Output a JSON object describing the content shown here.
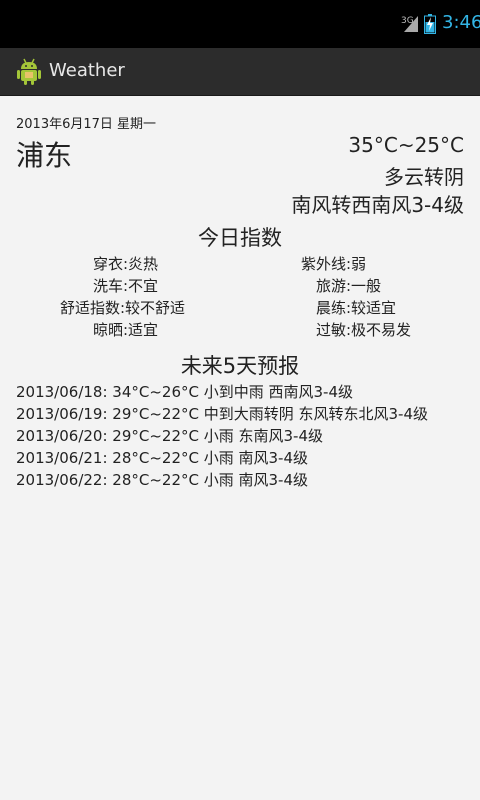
{
  "status_bar": {
    "network": "3G",
    "time": "3:46"
  },
  "action_bar": {
    "app_icon": "android-icon",
    "title": "Weather"
  },
  "current": {
    "date": "2013年6月17日 星期一",
    "city": "浦东",
    "temperature": "35°C~25°C",
    "weather": "多云转阴",
    "wind": "南风转西南风3-4级"
  },
  "indices": {
    "title": "今日指数",
    "items": [
      "穿衣:炎热",
      "紫外线:弱",
      "洗车:不宜",
      "旅游:一般",
      "舒适指数:较不舒适",
      "晨练:较适宜",
      "晾晒:适宜",
      "过敏:极不易发"
    ]
  },
  "forecast": {
    "title": "未来5天预报",
    "days": [
      "2013/06/18: 34°C~26°C 小到中雨 西南风3-4级",
      "2013/06/19: 29°C~22°C 中到大雨转阴 东风转东北风3-4级",
      "2013/06/20: 29°C~22°C 小雨 东南风3-4级",
      "2013/06/21: 28°C~22°C 小雨 南风3-4级",
      "2013/06/22: 28°C~22°C 小雨 南风3-4级"
    ]
  },
  "colors": {
    "clock": "#33b5e5",
    "background": "#f3f3f3",
    "action_bar": "#2c2c2c"
  }
}
